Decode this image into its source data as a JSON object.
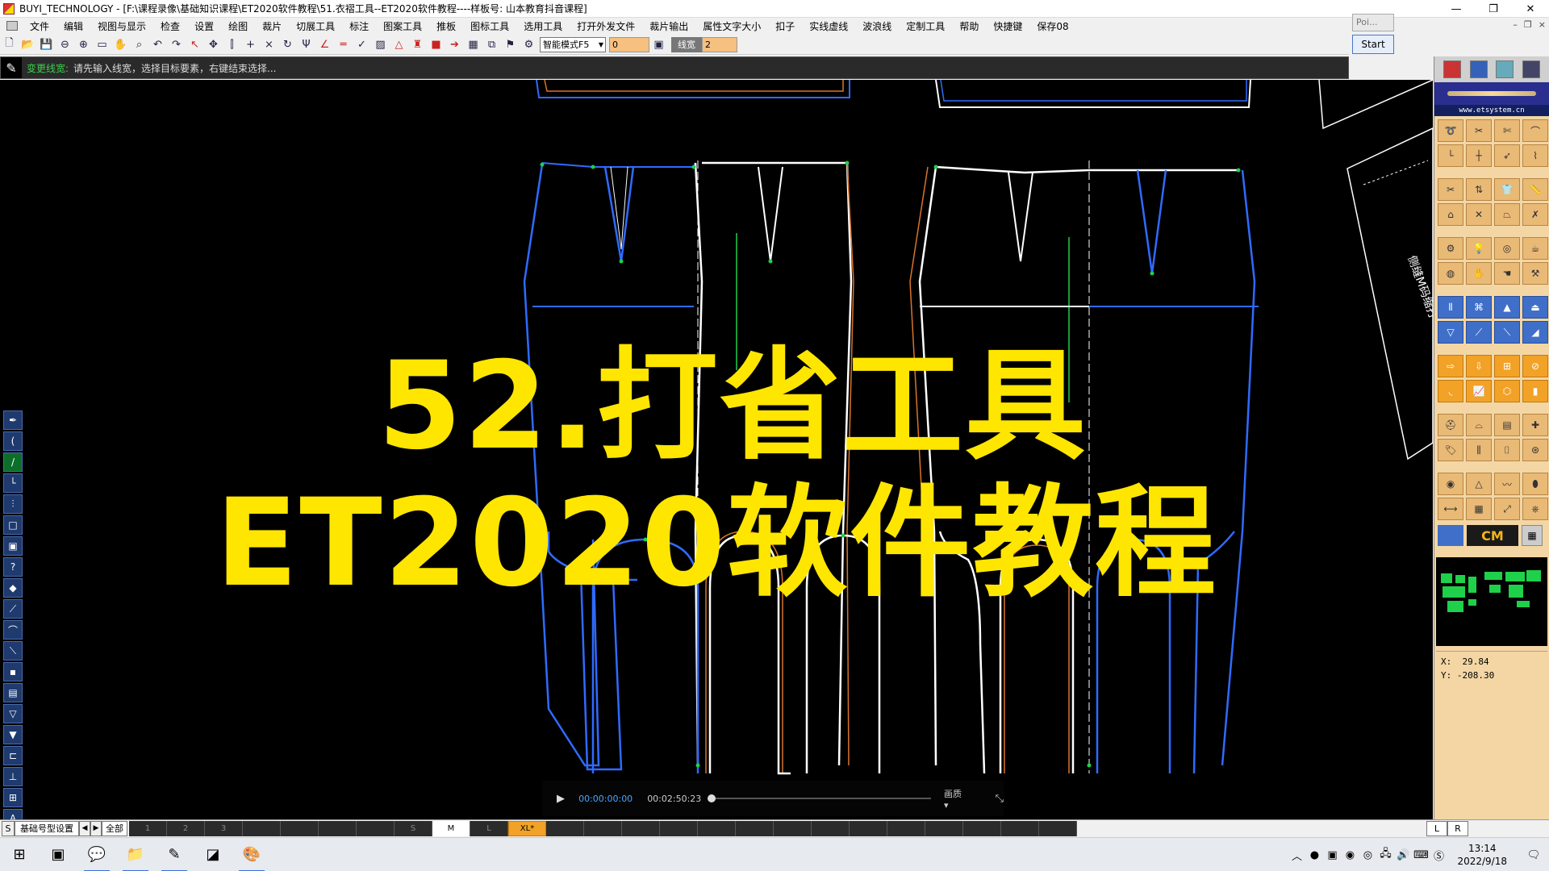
{
  "window": {
    "title": "BUYI_TECHNOLOGY - [F:\\课程录像\\基础知识课程\\ET2020软件教程\\51.衣褶工具--ET2020软件教程----样板号: 山本教育抖音课程]",
    "controls": [
      "—",
      "❐",
      "✕"
    ]
  },
  "menu": {
    "items": [
      "文件",
      "编辑",
      "视图与显示",
      "检查",
      "设置",
      "绘图",
      "裁片",
      "切展工具",
      "标注",
      "图案工具",
      "推板",
      "图标工具",
      "选用工具",
      "打开外发文件",
      "裁片输出",
      "属性文字大小",
      "扣子",
      "实线虚线",
      "波浪线",
      "定制工具",
      "帮助",
      "快捷键",
      "保存08"
    ],
    "mdi_controls": [
      "–",
      "❐",
      "×"
    ]
  },
  "toolbar": {
    "mode_select": "智能模式F5",
    "value1": "0",
    "line_width_label": "线宽",
    "line_width_value": "2"
  },
  "popup": {
    "small_label": "Poi...",
    "start_label": "Start"
  },
  "prompt": {
    "mode": "变更线宽:",
    "text": "请先输入线宽，选择目标要素，右键结束选择..."
  },
  "headline": {
    "line1": "52.打省工具",
    "line2": "ET2020软件教程"
  },
  "canvas_text": {
    "side_label": "侧缝M码缩打"
  },
  "video": {
    "current_time": "00:00:00:00",
    "total_time": "00:02:50:23",
    "quality": "画质 ▾",
    "progress": 0
  },
  "right_panel": {
    "url": "www.etsystem.cn",
    "cm_label": "CM",
    "coords": {
      "x_label": "X:",
      "x_value": "29.84",
      "y_label": "Y:",
      "y_value": "-208.30"
    }
  },
  "sizebar": {
    "s_label": "S",
    "tab_label": "基础号型设置",
    "all_label": "全部",
    "sizes": [
      "1",
      "2",
      "3",
      "",
      "",
      "",
      "",
      "S",
      "M",
      "L",
      "XL*",
      "",
      "",
      "",
      "",
      "",
      "",
      "",
      "",
      "",
      "",
      "",
      "",
      "",
      ""
    ],
    "active_size": "M",
    "l_label": "L",
    "r_label": "R"
  },
  "taskbar": {
    "time": "13:14",
    "date": "2022/9/18"
  },
  "colors": {
    "headline": "#ffe600",
    "pattern_blue": "#2f6bff",
    "pattern_white": "#ffffff",
    "pattern_orange": "#d9742a",
    "point_green": "#1fd04a"
  }
}
